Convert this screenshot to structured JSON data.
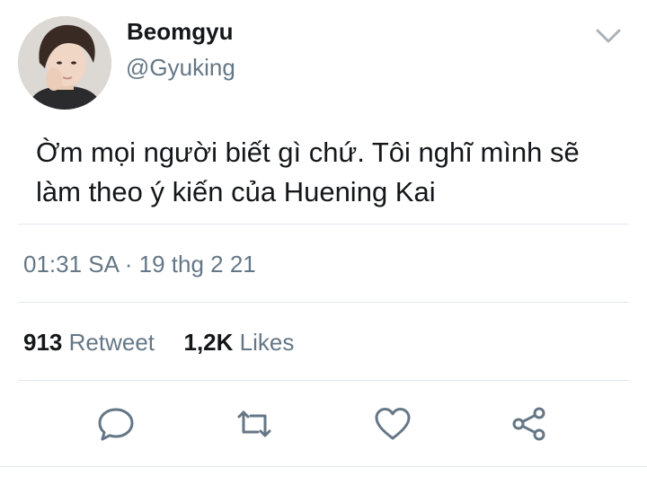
{
  "user": {
    "display_name": "Beomgyu",
    "handle": "@Gyuking"
  },
  "tweet": {
    "text_line1": "Ờm mọi người biết gì chứ. Tôi nghĩ mình sẽ",
    "text_line2": "làm theo ý kiến của Huening Kai",
    "timestamp": "01:31 SA · 19 thg 2 21"
  },
  "stats": {
    "retweets_count": "913",
    "retweets_label": "Retweet",
    "likes_count": "1,2K",
    "likes_label": "Likes"
  },
  "icons": {
    "menu": "chevron-down-icon",
    "reply": "reply-icon",
    "retweet": "retweet-icon",
    "like": "heart-icon",
    "share": "share-icon"
  },
  "colors": {
    "text": "#14171a",
    "secondary": "#657786",
    "icon": "#657786",
    "divider": "#e1e8ed",
    "chevron": "#a9b3ba"
  }
}
